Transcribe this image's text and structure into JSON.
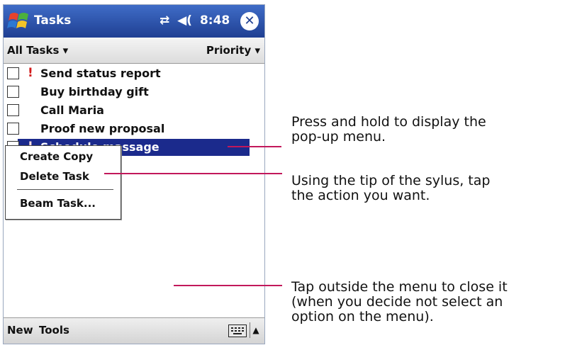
{
  "app": {
    "title": "Tasks",
    "clock": "8:48",
    "status_icons": [
      "connectivity-icon",
      "speaker-icon"
    ],
    "signal_glyph": "⇄",
    "speaker_glyph": "◀(",
    "close_glyph": "✕"
  },
  "filterbar": {
    "category": "All Tasks ▾",
    "sort": "Priority ▾"
  },
  "tasks": [
    {
      "label": "Send status report",
      "priority": "!",
      "checked": false
    },
    {
      "label": "Buy birthday gift",
      "priority": "",
      "checked": false
    },
    {
      "label": "Call Maria",
      "priority": "",
      "checked": false
    },
    {
      "label": "Proof new proposal",
      "priority": "",
      "checked": false
    },
    {
      "label": "Schedule massage",
      "priority": "!",
      "checked": false,
      "selected": true
    }
  ],
  "popup_menu": {
    "items": [
      "Create Copy",
      "Delete Task",
      "Beam Task..."
    ]
  },
  "bottombar": {
    "new_label": "New",
    "tools_label": "Tools",
    "sip_arrow": "▲"
  },
  "callouts": [
    "Press and hold to display the\npop-up menu.",
    "Using the tip of the sylus, tap\nthe action you want.",
    "Tap outside the menu to close it\n(when you decide not select an\noption on the menu)."
  ],
  "colors": {
    "titlebar": "#2a4fae",
    "selection": "#1b2a8c",
    "callout_line": "#c2185b",
    "priority": "#d21a1a"
  }
}
